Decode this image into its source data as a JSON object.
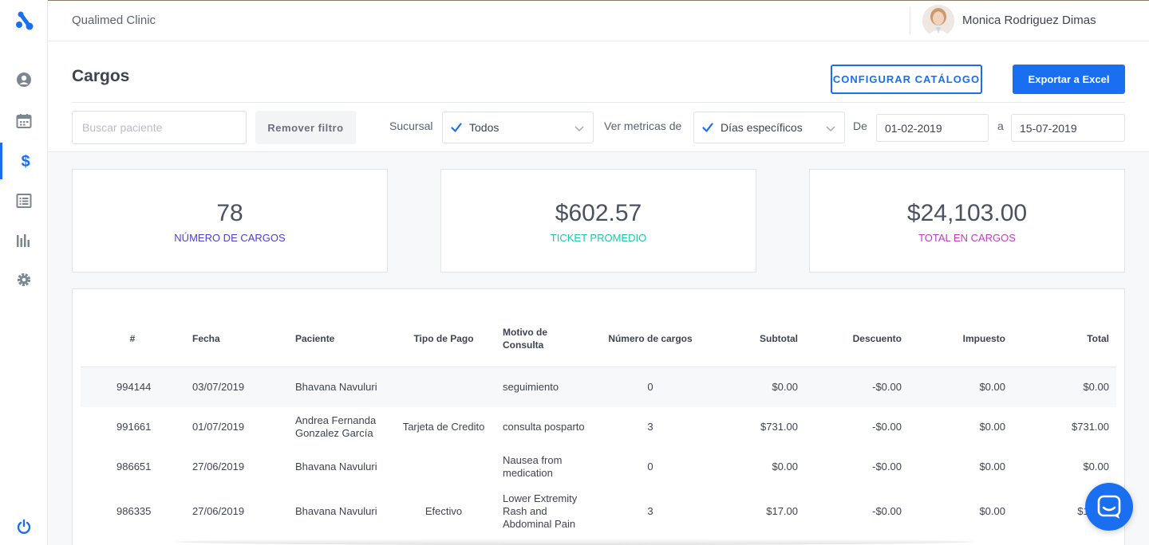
{
  "app": {
    "clinic_name": "Qualimed Clinic"
  },
  "user": {
    "name": "Monica Rodriguez Dimas"
  },
  "sidebar": {
    "items": [
      {
        "name": "patients",
        "icon": "user-circle-icon"
      },
      {
        "name": "calendar",
        "icon": "calendar-icon"
      },
      {
        "name": "charges",
        "icon": "dollar-icon",
        "active": true
      },
      {
        "name": "records",
        "icon": "list-icon"
      },
      {
        "name": "reports",
        "icon": "bar-chart-icon"
      },
      {
        "name": "settings",
        "icon": "gear-icon"
      }
    ],
    "logout_icon": "power-icon"
  },
  "page": {
    "title": "Cargos",
    "configure_button": "CONFIGURAR CATÁLOGO",
    "export_button": "Exportar a Excel"
  },
  "filters": {
    "search_placeholder": "Buscar paciente",
    "clear_button": "Remover filtro",
    "branch_label": "Sucursal",
    "branch_value": "Todos",
    "metrics_label": "Ver metricas de",
    "metrics_value": "Días específicos",
    "from_label": "De",
    "from_value": "01-02-2019",
    "to_label": "a",
    "to_value": "15-07-2019"
  },
  "stats": [
    {
      "value": "78",
      "label": "NÚMERO DE CARGOS",
      "color": "#4a3fd4"
    },
    {
      "value": "$602.57",
      "label": "TICKET PROMEDIO",
      "color": "#1dc9a0"
    },
    {
      "value": "$24,103.00",
      "label": "TOTAL EN CARGOS",
      "color": "#c23bc4"
    }
  ],
  "table": {
    "headers": {
      "id": "#",
      "date": "Fecha",
      "patient": "Paciente",
      "payment": "Tipo de Pago",
      "reason": "Motivo de Consulta",
      "count": "Número de cargos",
      "subtotal": "Subtotal",
      "discount": "Descuento",
      "tax": "Impuesto",
      "total": "Total"
    },
    "rows": [
      {
        "id": "994144",
        "date": "03/07/2019",
        "patient": "Bhavana Navuluri",
        "payment": "",
        "reason": "seguimiento",
        "count": "0",
        "subtotal": "$0.00",
        "discount": "-$0.00",
        "tax": "$0.00",
        "total": "$0.00"
      },
      {
        "id": "991661",
        "date": "01/07/2019",
        "patient": "Andrea Fernanda Gonzalez García",
        "payment": "Tarjeta de Credito",
        "reason": "consulta posparto",
        "count": "3",
        "subtotal": "$731.00",
        "discount": "-$0.00",
        "tax": "$0.00",
        "total": "$731.00"
      },
      {
        "id": "986651",
        "date": "27/06/2019",
        "patient": "Bhavana Navuluri",
        "payment": "",
        "reason": "Nausea from medication",
        "count": "0",
        "subtotal": "$0.00",
        "discount": "-$0.00",
        "tax": "$0.00",
        "total": "$0.00"
      },
      {
        "id": "986335",
        "date": "27/06/2019",
        "patient": "Bhavana Navuluri",
        "payment": "Efectivo",
        "reason": "Lower Extremity Rash and Abdominal Pain",
        "count": "3",
        "subtotal": "$17.00",
        "discount": "-$0.00",
        "tax": "$0.00",
        "total": "$17.00"
      }
    ]
  },
  "chat": {
    "icon": "chat-bubble-icon"
  }
}
